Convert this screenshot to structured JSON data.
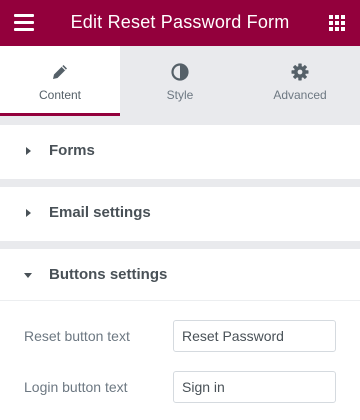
{
  "header": {
    "title": "Edit Reset Password Form",
    "menu_icon": "hamburger-menu-icon",
    "apps_icon": "grid-apps-icon",
    "color": "#93003c"
  },
  "tabs": [
    {
      "label": "Content",
      "icon": "pencil-icon",
      "active": true
    },
    {
      "label": "Style",
      "icon": "half-circle-icon",
      "active": false
    },
    {
      "label": "Advanced",
      "icon": "gear-icon",
      "active": false
    }
  ],
  "sections": [
    {
      "title": "Forms",
      "expanded": false
    },
    {
      "title": "Email settings",
      "expanded": false
    },
    {
      "title": "Buttons settings",
      "expanded": true
    }
  ],
  "controls": [
    {
      "label": "Reset button text",
      "value": "Reset Password"
    },
    {
      "label": "Login button text",
      "value": "Sign in"
    }
  ]
}
